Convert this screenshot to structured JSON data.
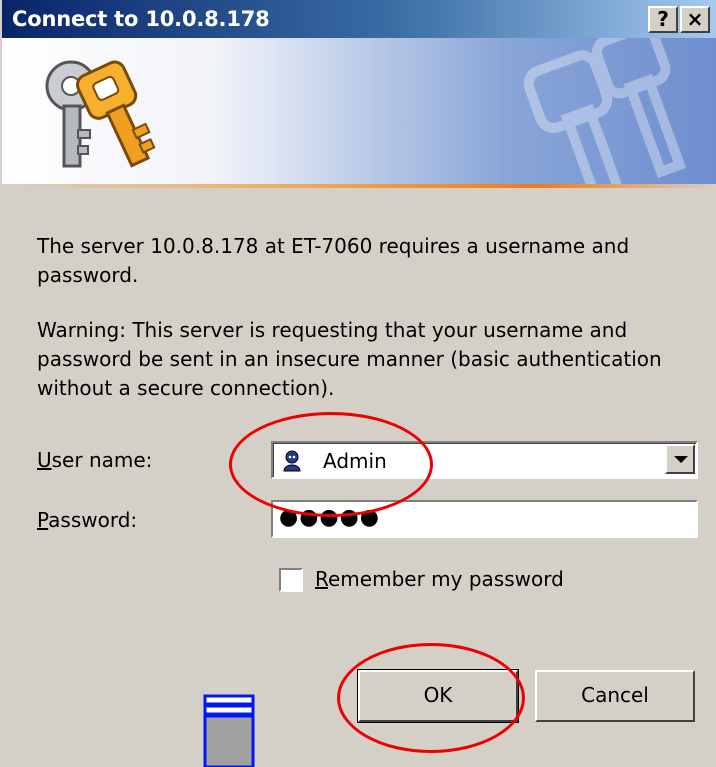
{
  "window": {
    "title": "Connect to 10.0.8.178",
    "help_glyph": "?",
    "close_glyph": "×"
  },
  "banner": {
    "icon": "keys-icon"
  },
  "message": {
    "line1": "The server 10.0.8.178 at ET-7060 requires a username and password.",
    "warning": "Warning: This server is requesting that your username and password be sent in an insecure manner (basic authentication without a secure connection)."
  },
  "form": {
    "username_label_u": "U",
    "username_label_rest": "ser name:",
    "username_value": "Admin",
    "username_icon": "user-icon",
    "password_label_p": "P",
    "password_label_rest": "assword:",
    "password_mask": "●●●●●",
    "remember_label_r": "R",
    "remember_label_rest": "emember my password",
    "remember_checked": false
  },
  "buttons": {
    "ok": "OK",
    "cancel": "Cancel"
  },
  "colors": {
    "annotation": "#e00000",
    "dialog_bg": "#d4d0c8",
    "title_start": "#0a246a"
  }
}
